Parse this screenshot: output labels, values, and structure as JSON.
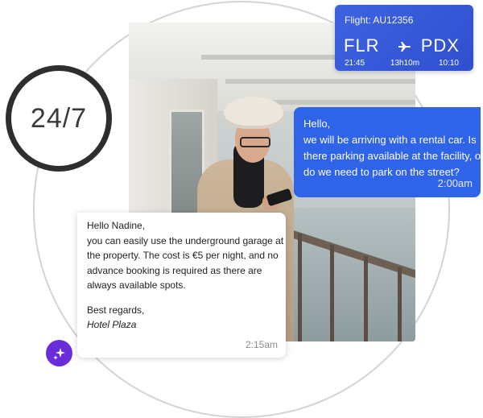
{
  "badge": {
    "text": "24/7"
  },
  "flight": {
    "label": "Flight: AU12356",
    "from_code": "FLR",
    "to_code": "PDX",
    "depart_time": "21:45",
    "duration": "13h10m",
    "arrive_time": "10:10",
    "icon": "airplane-icon"
  },
  "guest_message": {
    "lines": [
      "Hello,",
      "we will be arriving with a rental car. Is",
      "there parking available at the facility, or",
      "do we need to park on the street?"
    ],
    "time": "2:00am"
  },
  "reply_message": {
    "lines": [
      "Hello Nadine,",
      "you can easily use the underground garage at",
      "the property. The cost is €5 per night, and no",
      "advance booking is required as there are",
      "always available spots."
    ],
    "closing": "Best regards,",
    "signature": "Hotel Plaza",
    "time": "2:15am"
  },
  "ai_button": {
    "icon": "sparkle-icon"
  },
  "colors": {
    "flight_card": "#3559d8",
    "guest_bubble": "#2f63e8",
    "ai_button": "#6a2bd9",
    "ring": "#d0d0d0"
  }
}
